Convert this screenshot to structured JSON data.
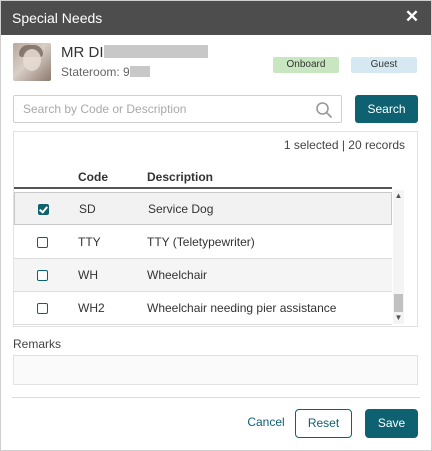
{
  "dialog": {
    "title": "Special Needs",
    "close_icon": "close-icon"
  },
  "guest": {
    "name_prefix": "MR DI",
    "stateroom_label": "Stateroom: 9",
    "badges": [
      "Onboard",
      "Guest"
    ],
    "colors": {
      "onboard": "#c8e6c0",
      "guest": "#d6e8f2"
    }
  },
  "search": {
    "placeholder": "Search by Code or Description",
    "value": "",
    "button_label": "Search",
    "icon": "search-icon"
  },
  "table": {
    "summary": "1 selected | 20 records",
    "columns": [
      "Code",
      "Description"
    ],
    "rows": [
      {
        "code": "SD",
        "description": "Service Dog",
        "checked": true
      },
      {
        "code": "TTY",
        "description": "TTY (Teletypewriter)",
        "checked": false
      },
      {
        "code": "WH",
        "description": "Wheelchair",
        "checked": false
      },
      {
        "code": "WH2",
        "description": "Wheelchair needing pier assistance",
        "checked": false
      }
    ]
  },
  "remarks": {
    "label": "Remarks",
    "value": ""
  },
  "footer": {
    "cancel_label": "Cancel",
    "reset_label": "Reset",
    "save_label": "Save"
  },
  "theme": {
    "accent": "#0e6170",
    "header_bg": "#4d4d4d"
  }
}
